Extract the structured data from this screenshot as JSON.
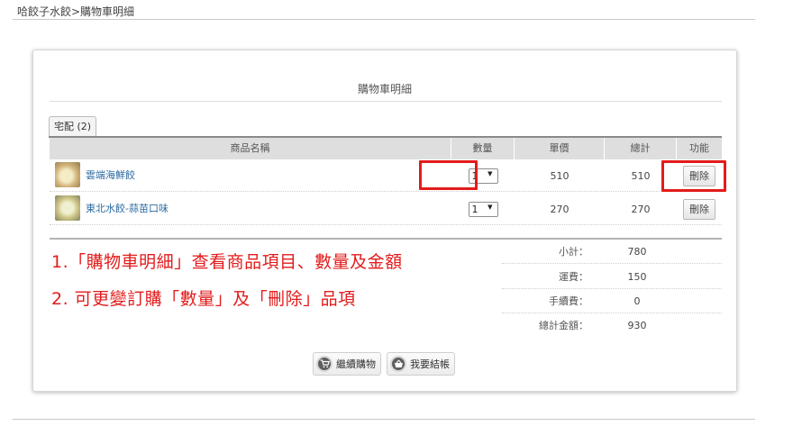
{
  "breadcrumb": "哈餃子水餃>購物車明細",
  "panel": {
    "title": "購物車明細",
    "tab_label": "宅配 (2)"
  },
  "table": {
    "headers": [
      "商品名稱",
      "數量",
      "單價",
      "總計",
      "功能"
    ],
    "rows": [
      {
        "name": "雲端海鮮餃",
        "qty": "1",
        "price": "510",
        "total": "510",
        "action": "刪除"
      },
      {
        "name": "東北水餃-蒜苗口味",
        "qty": "1",
        "price": "270",
        "total": "270",
        "action": "刪除"
      }
    ]
  },
  "summary": [
    {
      "label": "小計：",
      "value": "780"
    },
    {
      "label": "運費：",
      "value": "150"
    },
    {
      "label": "手續費：",
      "value": "0"
    },
    {
      "label": "總計金額：",
      "value": "930"
    }
  ],
  "annotations": {
    "line1": "1.「購物車明細」查看商品項目、數量及金額",
    "line2": "2. 可更變訂購「數量」及「刪除」品項",
    "highlight_color": "#e31b1b"
  },
  "buttons": {
    "continue_shopping": "繼續購物",
    "checkout": "我要結帳"
  },
  "icons": {
    "continue_shopping": "shopping-cart-icon",
    "checkout": "basket-icon",
    "dropdown": "caret-down-icon"
  }
}
